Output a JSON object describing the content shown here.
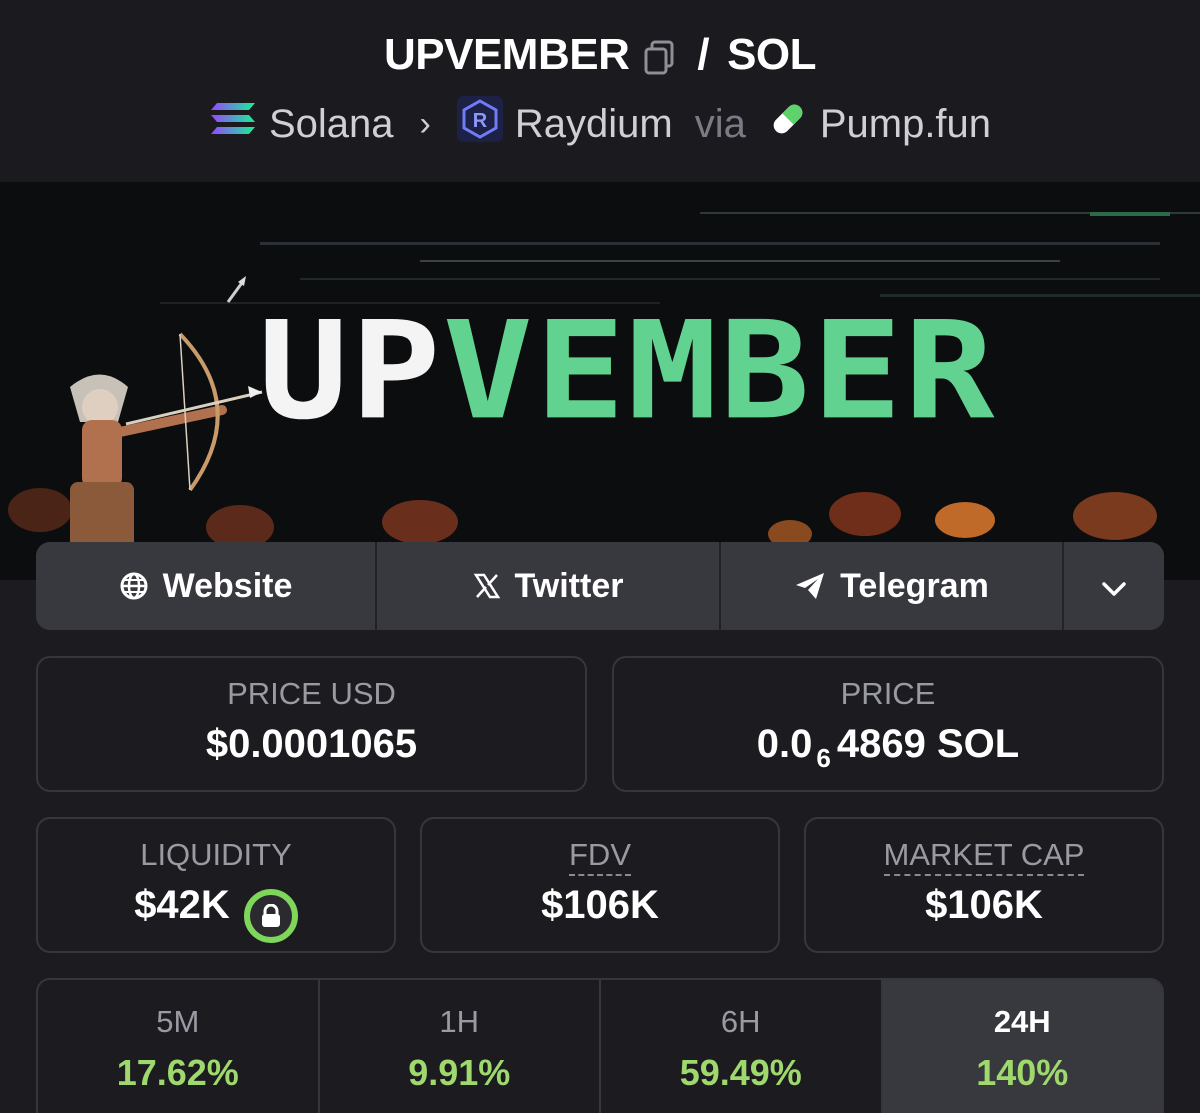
{
  "header": {
    "token_symbol": "UPVEMBER",
    "separator": "/",
    "quote_symbol": "SOL",
    "chain": "Solana",
    "dex": "Raydium",
    "via_label": "via",
    "launchpad": "Pump.fun"
  },
  "banner": {
    "word_white": "UP",
    "word_green": "VEMBER"
  },
  "links": {
    "website": "Website",
    "twitter": "Twitter",
    "telegram": "Telegram"
  },
  "stats": {
    "price_usd_label": "PRICE USD",
    "price_usd_value": "$0.0001065",
    "price_label": "PRICE",
    "price_prefix": "0.0",
    "price_zeros": "6",
    "price_suffix": "4869 SOL",
    "liquidity_label": "LIQUIDITY",
    "liquidity_value": "$42K",
    "fdv_label": "FDV",
    "fdv_value": "$106K",
    "mcap_label": "MARKET CAP",
    "mcap_value": "$106K"
  },
  "timeframes": [
    {
      "label": "5M",
      "change": "17.62%"
    },
    {
      "label": "1H",
      "change": "9.91%"
    },
    {
      "label": "6H",
      "change": "59.49%"
    },
    {
      "label": "24H",
      "change": "140%"
    }
  ],
  "colors": {
    "background": "#1b1b20",
    "positive": "#9fd86c",
    "banner_green": "#61d28f",
    "lock_ring": "#7ed65a"
  }
}
